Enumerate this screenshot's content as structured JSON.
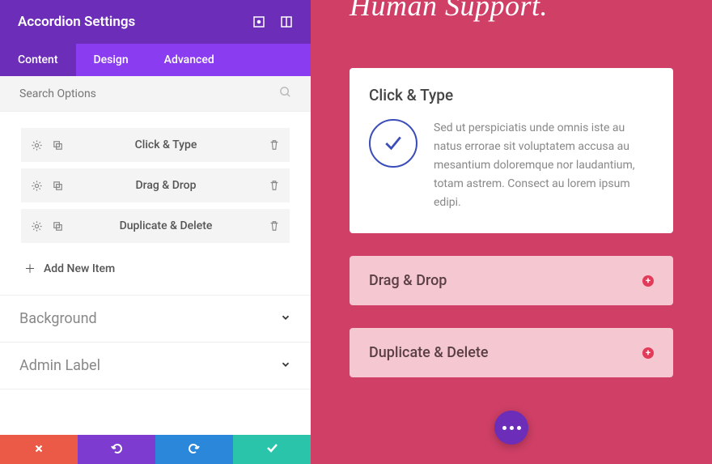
{
  "panel": {
    "title": "Accordion Settings",
    "tabs": {
      "content": "Content",
      "design": "Design",
      "advanced": "Advanced"
    },
    "search_placeholder": "Search Options",
    "items": [
      {
        "label": "Click & Type"
      },
      {
        "label": "Drag & Drop"
      },
      {
        "label": "Duplicate & Delete"
      }
    ],
    "add_item_label": "Add New Item",
    "sections": {
      "background": "Background",
      "admin_label": "Admin Label"
    }
  },
  "preview": {
    "heading": "Human Support.",
    "accordion": {
      "open": {
        "title": "Click & Type",
        "body": "Sed ut perspiciatis unde omnis iste au natus errorae sit voluptatem accusa au mesantium doloremque nor laudantium, totam astrem. Consect au lorem ipsum edipi."
      },
      "closed": [
        {
          "title": "Drag & Drop"
        },
        {
          "title": "Duplicate & Delete"
        }
      ]
    }
  }
}
